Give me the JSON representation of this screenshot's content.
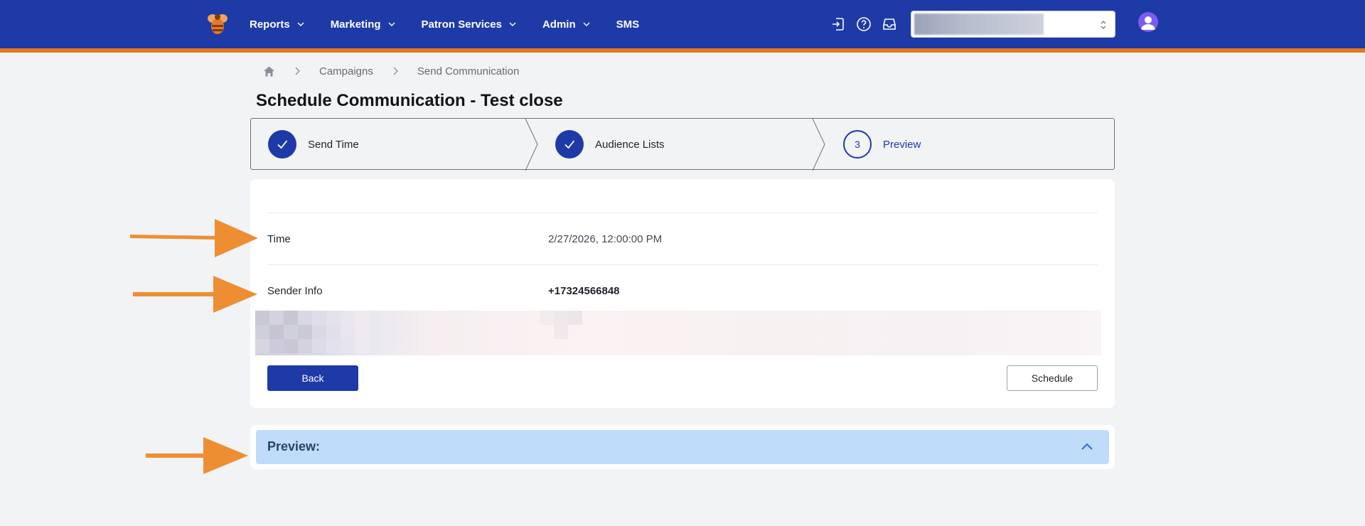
{
  "nav": {
    "items": [
      {
        "label": "Reports",
        "has_dropdown": true
      },
      {
        "label": "Marketing",
        "has_dropdown": true
      },
      {
        "label": "Patron Services",
        "has_dropdown": true
      },
      {
        "label": "Admin",
        "has_dropdown": true
      },
      {
        "label": "SMS",
        "has_dropdown": false
      }
    ],
    "icons": [
      "sign-out-icon",
      "help-icon",
      "inbox-icon"
    ],
    "org_select_value": "",
    "colors": {
      "bar": "#1d3aa7",
      "stripe": "#e07a1d"
    }
  },
  "breadcrumb": {
    "items": [
      "Campaigns",
      "Send Communication"
    ]
  },
  "page": {
    "title": "Schedule Communication - Test close"
  },
  "stepper": {
    "steps": [
      {
        "label": "Send Time",
        "status": "done"
      },
      {
        "label": "Audience Lists",
        "status": "done"
      },
      {
        "label": "Preview",
        "status": "current",
        "number": "3"
      }
    ]
  },
  "details": {
    "time_label": "Time",
    "time_value": "2/27/2026, 12:00:00 PM",
    "sender_label": "Sender Info",
    "sender_value": "+17324566848"
  },
  "actions": {
    "back_label": "Back",
    "schedule_label": "Schedule"
  },
  "preview": {
    "title": "Preview:",
    "expanded": true
  },
  "annotation_color": "#ee8e33"
}
